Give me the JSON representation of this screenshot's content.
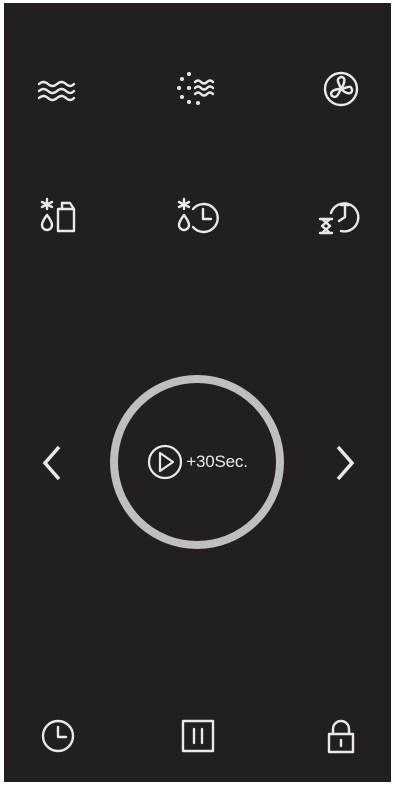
{
  "program_buttons": [
    {
      "name": "top-bottom-heat",
      "icon": "wave-lines-icon"
    },
    {
      "name": "steam-mode",
      "icon": "steam-dots-icon"
    },
    {
      "name": "fan-mode",
      "icon": "fan-icon"
    },
    {
      "name": "defrost-mode",
      "icon": "defrost-icon"
    },
    {
      "name": "defrost-timer",
      "icon": "defrost-clock-icon"
    },
    {
      "name": "delay-start",
      "icon": "hourglass-clock-icon"
    }
  ],
  "navigation": {
    "prev_icon": "chevron-left-icon",
    "next_icon": "chevron-right-icon"
  },
  "dial": {
    "icon": "play-icon",
    "label": "+30Sec."
  },
  "bottom_bar": [
    {
      "name": "timer",
      "icon": "clock-icon"
    },
    {
      "name": "pause",
      "icon": "pause-icon"
    },
    {
      "name": "lock",
      "icon": "lock-icon"
    }
  ],
  "colors": {
    "background": "#231f20",
    "icon": "#e9e9e9",
    "dial_ring": "#bfbfbf"
  }
}
